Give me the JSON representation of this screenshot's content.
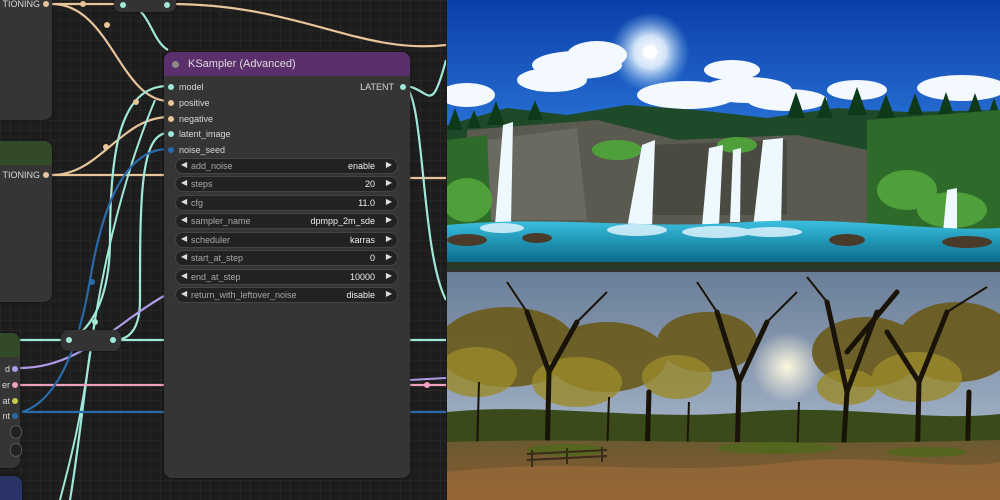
{
  "nodes": {
    "cond_top": {
      "output_label": "TIONING"
    },
    "cond_mid": {
      "output_label": "TIONING"
    },
    "left_partial": {
      "labels": [
        "d",
        "er",
        "at",
        "nt"
      ]
    },
    "ksampler": {
      "title": "KSampler (Advanced)",
      "inputs": [
        "model",
        "positive",
        "negative",
        "latent_image",
        "noise_seed"
      ],
      "output": "LATENT",
      "widgets": [
        {
          "name": "add_noise",
          "value": "enable"
        },
        {
          "name": "steps",
          "value": "20"
        },
        {
          "name": "cfg",
          "value": "11.0"
        },
        {
          "name": "sampler_name",
          "value": "dpmpp_2m_sde"
        },
        {
          "name": "scheduler",
          "value": "karras"
        },
        {
          "name": "start_at_step",
          "value": "0"
        },
        {
          "name": "end_at_step",
          "value": "10000"
        },
        {
          "name": "return_with_leftover_noise",
          "value": "disable"
        }
      ]
    }
  },
  "colors": {
    "model": "#a0e8d8",
    "conditioning": "#e8c49a",
    "latent": "#f0a0c0",
    "int": "#2a6aa8",
    "clip": "#b09ae8",
    "ksampler_header": "#5a2f6b",
    "cond_header": "#334a2a"
  },
  "images": {
    "top": "waterfall-equirectangular-panorama",
    "bottom": "forest-equirectangular-panorama"
  }
}
